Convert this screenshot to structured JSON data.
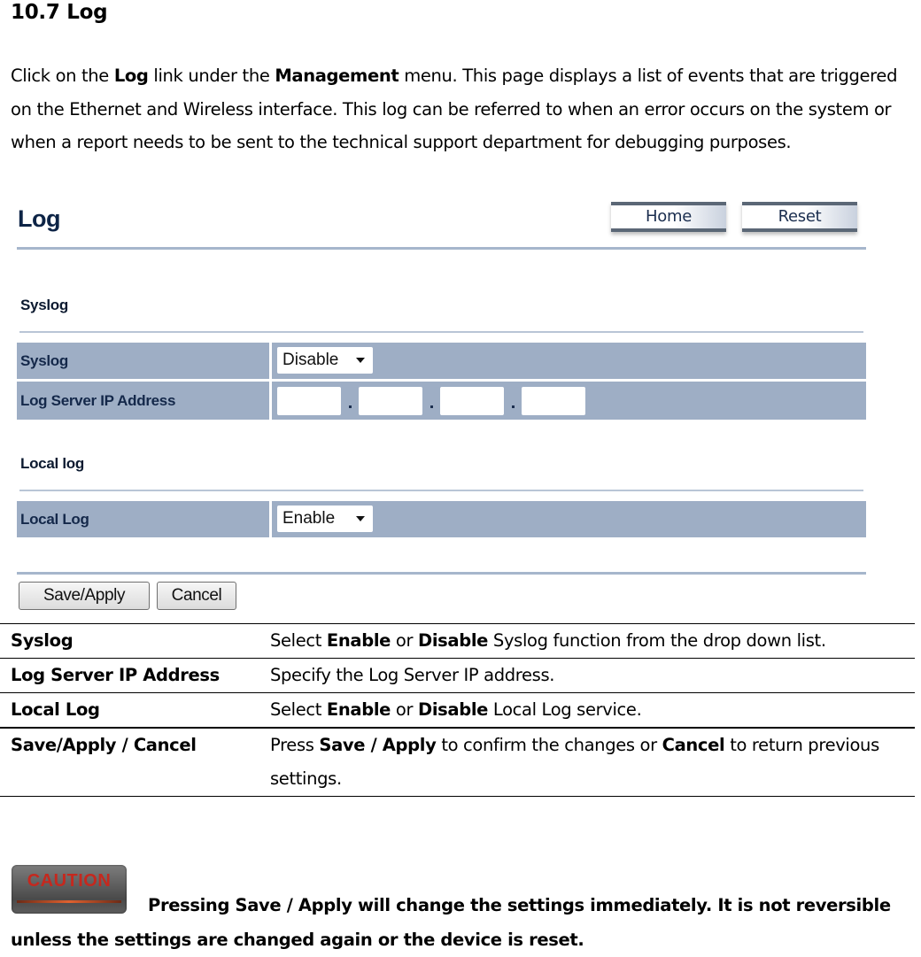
{
  "section": {
    "heading": "10.7 Log",
    "intro": {
      "p1": "Click on the ",
      "link1": "Log",
      "p2": " link under the ",
      "link2": "Management",
      "p3": " menu. This page displays a list of events that are triggered on the Ethernet and Wireless interface. This log can be referred to when an error occurs on the system or when a report needs to be sent to the technical support department for debugging purposes."
    }
  },
  "panel": {
    "title": "Log",
    "home_button": "Home",
    "reset_button": "Reset",
    "syslog_section": "Syslog",
    "syslog_label": "Syslog",
    "syslog_value": "Disable",
    "log_server_label": "Log Server IP Address",
    "log_server_ip": [
      "",
      "",
      "",
      ""
    ],
    "ip_separator": ".",
    "local_section": "Local log",
    "local_log_label": "Local Log",
    "local_log_value": "Enable",
    "save_button": "Save/Apply",
    "cancel_button": "Cancel"
  },
  "table": {
    "rows": [
      {
        "key": "Syslog",
        "v1": "Select ",
        "b1": "Enable",
        "v2": " or ",
        "b2": "Disable",
        "v3": " Syslog function from the drop down list."
      },
      {
        "key": "Log Server IP Address",
        "v1": "Specify the Log Server IP address."
      },
      {
        "key": "Local Log",
        "v1": "Select ",
        "b1": "Enable",
        "v2": " or ",
        "b2": "Disable",
        "v3": " Local Log service."
      },
      {
        "key": "Save/Apply / Cancel",
        "v1": "Press ",
        "b1": "Save / Apply",
        "v2": " to confirm the changes or ",
        "b2": "Cancel",
        "v3": " to return previous settings."
      }
    ]
  },
  "caution": {
    "badge": "CAUTION",
    "text": "Pressing Save / Apply will change the settings immediately. It is not reversible unless the settings are changed again or the device is reset."
  }
}
